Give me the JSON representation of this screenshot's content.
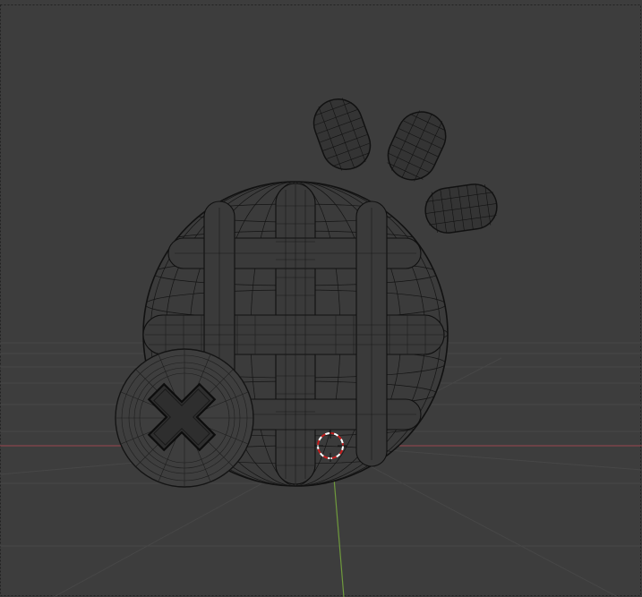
{
  "app": "Blender",
  "view": {
    "mode": "wireframe",
    "background_color": "#3d3d3d",
    "grid_color": "#474747",
    "x_axis_color": "#9a4850",
    "y_axis_color": "#6f9a3d",
    "wire_color": "#111111"
  },
  "objects": [
    {
      "name": "caged-sphere",
      "type": "mesh"
    },
    {
      "name": "cross-button-disc",
      "type": "mesh"
    },
    {
      "name": "capsule-1",
      "type": "mesh"
    },
    {
      "name": "capsule-2",
      "type": "mesh"
    },
    {
      "name": "capsule-3",
      "type": "mesh"
    }
  ],
  "cursor": {
    "name": "3d-cursor",
    "colors": [
      "#ffffff",
      "#c81e1e"
    ]
  }
}
